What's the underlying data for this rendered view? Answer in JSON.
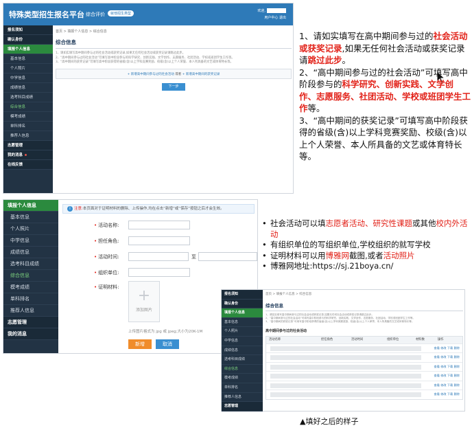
{
  "panel1": {
    "brand": "特殊类型招生报名平台",
    "nav_item": "综合评价",
    "nav_pill": "就他招生类型",
    "user_label": "欢迎,",
    "user_links": "用户中心  退出",
    "sidebar": [
      "报名须知",
      "确认身份",
      "填报个人信息",
      "基本信息",
      "个人照片",
      "中学信息",
      "成绩信息",
      "选考科目成绩",
      "综合信息",
      "模考成绩",
      "单科排名",
      "推荐人信息",
      "志愿管理",
      "我的消息",
      "在线反馈"
    ],
    "breadcrumb": "首页 > 填报个人信息 > 综合信息",
    "section_title": "综合信息",
    "notes": [
      "1、请如实填写高中期间参与过的社会活动或获奖记录,如果无任何社会活动或获奖记录请跳过此步。",
      "2、“高中期间参与过的社会活动”可填写高中阶段参与的科学研究、创新实践、文学创作、志愿服务、社团活动、学校或班团学生工作等。",
      "3、“高中期间的获奖记录”可填写高中阶段获得的省级(含)以上学科竞赛奖励、校级(含)以上个人荣誉、本人所具备的文艺或体育特长等。"
    ],
    "add_link_1": "+ 新增高中期间参与过的社会活动",
    "add_or": "或者",
    "add_link_2": "+ 新增高中期间的获奖记录",
    "next_button": "下一步"
  },
  "right_text": {
    "l1a": "1、请如实填写在高中期间参与过的",
    "l1b": "社会活动或获奖记录",
    "l1c": ",如果无任何社会活动或获奖记录请",
    "l1d": "跳过此步",
    "l1e": "。",
    "l2a": "2、“高中期间参与过的社会活动”可填写高中阶段参与的",
    "l2b": "科学研究、创新实践、文学创作、志愿服务、社团活动、学校或班团学生工作",
    "l2c": "等。",
    "l3": "3、“高中期间的获奖记录”可填写高中阶段获得的省级(含)以上学科竞赛奖励、校级(含)以上个人荣誉、本人所具备的文艺或体育特长等。"
  },
  "panel2": {
    "sidebar": [
      "填报个人信息",
      "基本信息",
      "个人照片",
      "中学信息",
      "成绩信息",
      "选考科目成绩",
      "综合信息",
      "模考成绩",
      "单科排名",
      "推荐人信息",
      "志愿管理",
      "我的消息"
    ],
    "notice_prefix": "注意:",
    "notice": "本页面对于证明材料的删除、上传操作,均在点击“新增”或“保存”按钮之后才会生效。",
    "fields": {
      "activity_name": "活动名称:",
      "role": "担任角色:",
      "time": "活动时间:",
      "time_sep": "至",
      "org": "组织单位:",
      "proof": "证明材料:"
    },
    "upload_label": "添加图片",
    "upload_hint": "上传图片格式为 jpg 或 jpeg;大小为20K-1M",
    "add_button": "新增",
    "cancel_button": "取消"
  },
  "bullets": {
    "b1a": "社会活动可以填",
    "b1b": "志愿者活动、研究性课题",
    "b1c": "或其他",
    "b1d": "校内外活动",
    "b2": "有组织单位的写组织单位,学校组织的就写学校",
    "b3a": "证明材料可以用",
    "b3b": "博雅网",
    "b3c": "截图,或者",
    "b3d": "活动照片",
    "b4": "博雅网地址:https://sj.21boya.cn/"
  },
  "panel3": {
    "sidebar": [
      "报名须知",
      "确认身份",
      "填报个人信息",
      "基本信息",
      "个人照片",
      "中学信息",
      "成绩信息",
      "选考科目成绩",
      "综合信息",
      "模考成绩",
      "单科排名",
      "推荐人信息",
      "志愿管理"
    ],
    "breadcrumb": "首页 > 填报个人信息 > 综合信息",
    "section_title": "综合信息",
    "table_title": "高中期间参与过的社会活动",
    "headers": [
      "活动名称",
      "担任角色",
      "活动时间",
      "组织单位",
      "材料数",
      "操作"
    ],
    "row_ops": "查看 修改 下载 删除"
  },
  "caption": "▲填好之后的样子"
}
